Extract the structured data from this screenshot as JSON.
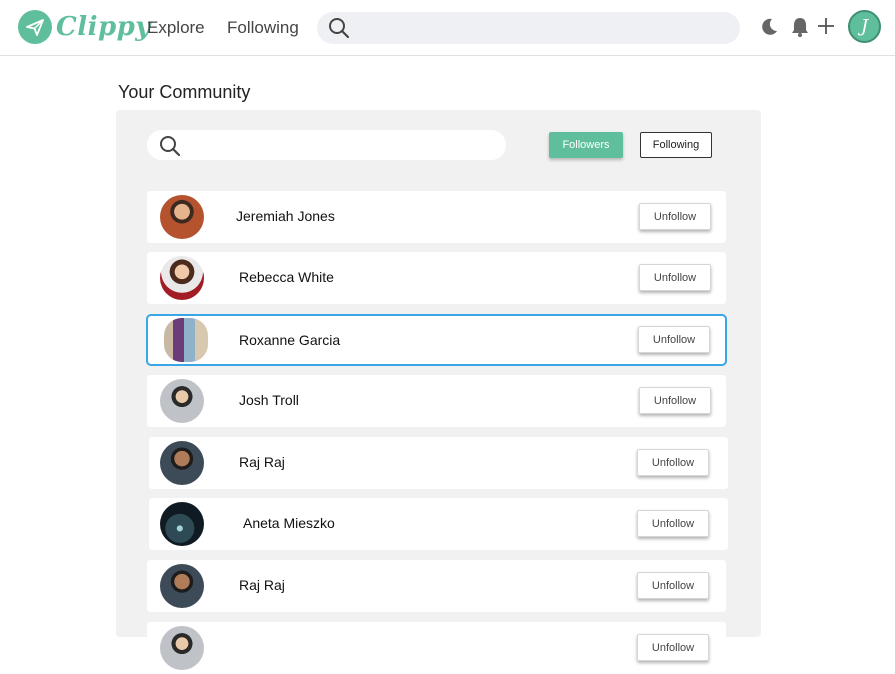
{
  "app": {
    "name": "Clippy",
    "user_initial": "J",
    "accent": "#5fbf9d",
    "selection": "#39a6e6"
  },
  "nav": {
    "links": [
      "Explore",
      "Following"
    ],
    "icons": [
      "search-icon",
      "moon-icon",
      "bell-icon",
      "plus-icon"
    ]
  },
  "section": {
    "title": "Your Community"
  },
  "tabs": {
    "followers": "Followers",
    "following": "Following",
    "active": "followers"
  },
  "rows": [
    {
      "name": "Jeremiah Jones",
      "action": "Unfollow"
    },
    {
      "name": "Rebecca White",
      "action": "Unfollow"
    },
    {
      "name": "Roxanne Garcia",
      "action": "Unfollow",
      "selected": true
    },
    {
      "name": "Josh Troll",
      "action": "Unfollow"
    },
    {
      "name": "Raj Raj",
      "action": "Unfollow"
    },
    {
      "name": "Aneta Mieszko",
      "action": "Unfollow"
    },
    {
      "name": "Raj Raj",
      "action": "Unfollow"
    },
    {
      "name": "",
      "action": "Unfollow"
    }
  ]
}
